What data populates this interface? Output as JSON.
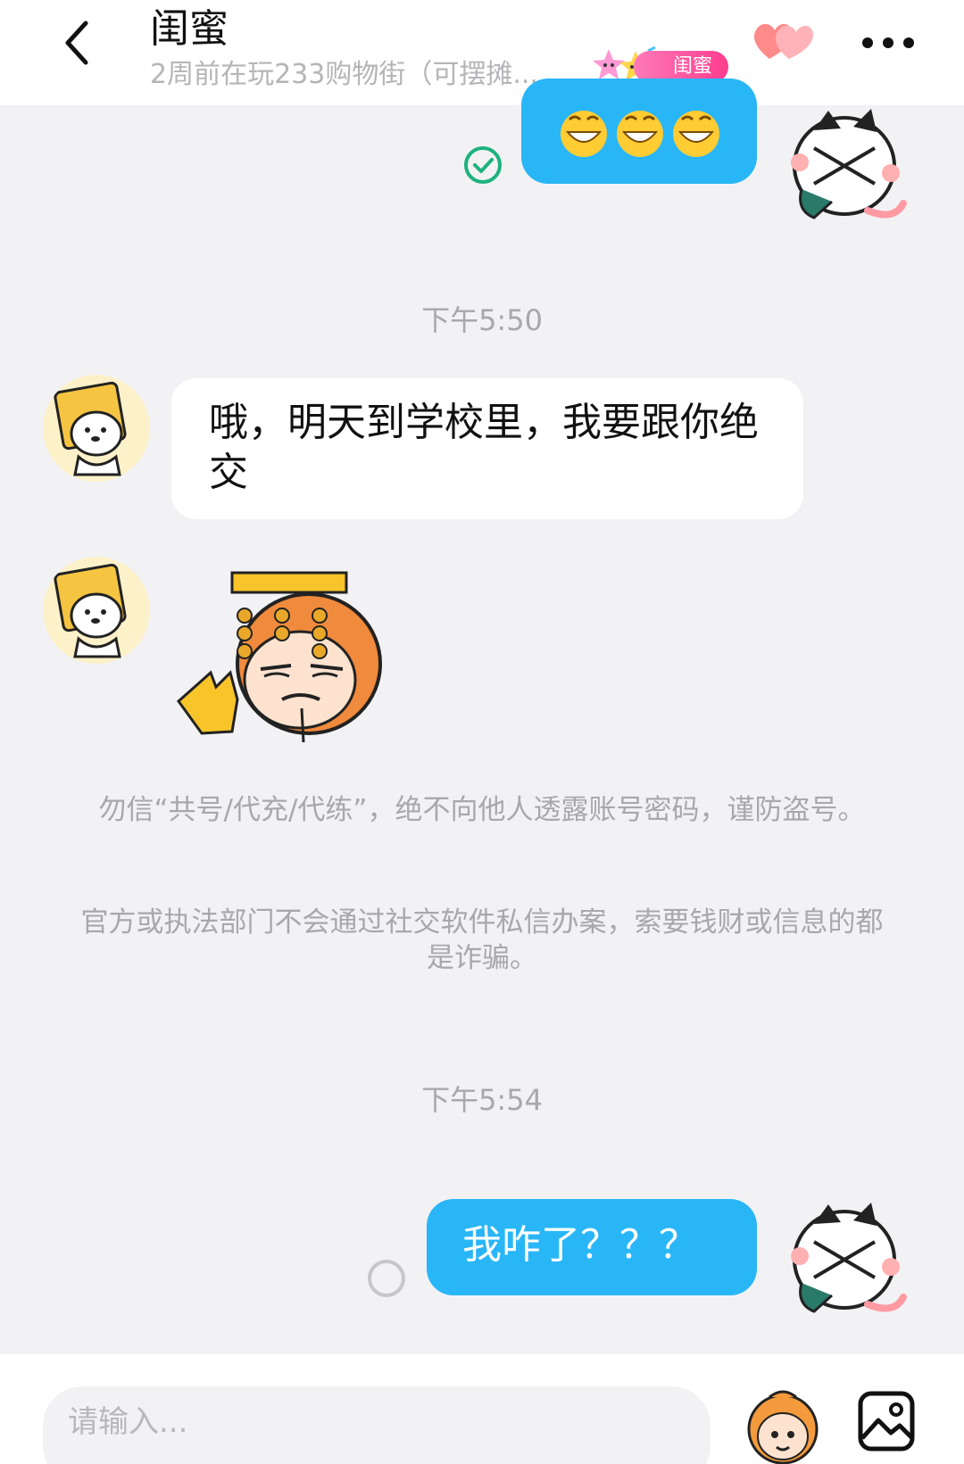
{
  "header": {
    "title": "闺蜜",
    "subtitle": "2周前在玩233购物街（可摆摊...",
    "badge_label": "闺蜜"
  },
  "messages": {
    "msg1_emoji": "😁😁😁",
    "time1": "下午5:50",
    "msg2_text": "哦，明天到学校里，我要跟你绝交",
    "notice1": "勿信“共号/代充/代练”，绝不向他人透露账号密码，谨防盗号。",
    "notice2": "官方或执法部门不会通过社交软件私信办案，索要钱财或信息的都是诈骗。",
    "time2": "下午5:54",
    "msg3_text": "我咋了？？？"
  },
  "input": {
    "placeholder": "请输入..."
  },
  "colors": {
    "accent_blue": "#29b6f6",
    "sent_check": "#1db27e",
    "badge_pink": "#ff4f9a"
  }
}
